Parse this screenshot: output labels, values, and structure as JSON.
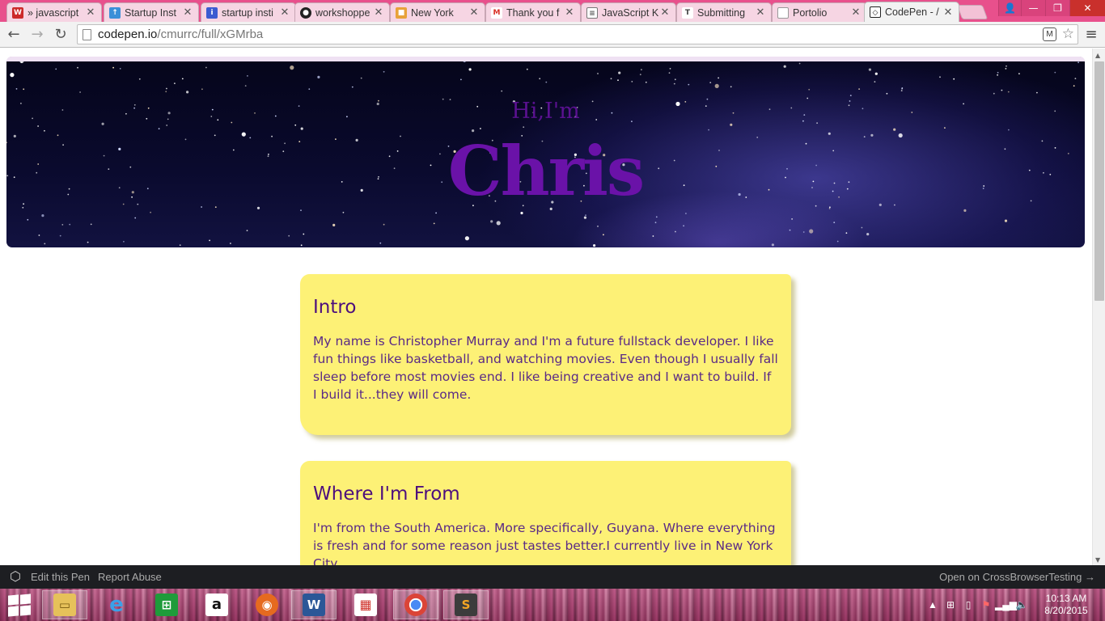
{
  "browser": {
    "tabs": [
      {
        "label": "» javascript",
        "favicon": "w3r",
        "color": "#cc2a2a"
      },
      {
        "label": "Startup Inst",
        "favicon": "arrow-up",
        "color": "#3a8fd8"
      },
      {
        "label": "startup insti",
        "favicon": "info",
        "color": "#3b5bd1"
      },
      {
        "label": "workshoppe",
        "favicon": "github",
        "color": "#222222"
      },
      {
        "label": "New York",
        "favicon": "package",
        "color": "#e8a23a"
      },
      {
        "label": "Thank you f",
        "favicon": "gmail",
        "color": "#d93025"
      },
      {
        "label": "JavaScript K",
        "favicon": "document",
        "color": "#555555"
      },
      {
        "label": "Submitting",
        "favicon": "typeform",
        "color": "#444444"
      },
      {
        "label": "Portolio",
        "favicon": "page",
        "color": "#888888"
      },
      {
        "label": "CodePen - /",
        "favicon": "codepen",
        "color": "#222222"
      }
    ],
    "url_host": "codepen.io",
    "url_path": "/cmurrc/full/xGMrba"
  },
  "hero": {
    "greeting": "Hi,I'm",
    "name": "Chris"
  },
  "cards": [
    {
      "title": "Intro",
      "body": "My name is Christopher Murray and I'm a future fullstack developer. I like fun things like basketball, and watching movies. Even though I usually fall sleep before most movies end. I like being creative and I want to build. If I build it...they will come."
    },
    {
      "title": "Where I'm From",
      "body": "I'm from the South America. More specifically, Guyana. Where everything is fresh and for some reason just tastes better.I currently live in New York City"
    }
  ],
  "codepen_bar": {
    "edit_label": "Edit this Pen",
    "report_label": "Report Abuse",
    "open_label": "Open on CrossBrowserTesting →"
  },
  "taskbar": {
    "time": "10:13 AM",
    "date": "8/20/2015"
  }
}
